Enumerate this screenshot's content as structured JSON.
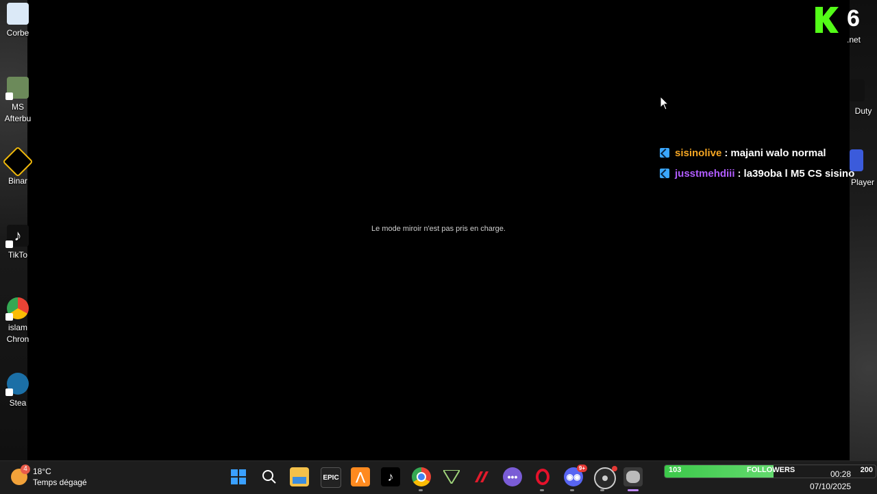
{
  "desktop": {
    "left_icons": [
      {
        "label": "Corbe",
        "icon": "recycle-bin-icon",
        "color": "#5fb3ff"
      },
      {
        "label1": "MS",
        "label2": "Afterbu",
        "icon": "msi-afterburner-icon",
        "color": "#6c8a5a"
      },
      {
        "label": "Binar",
        "icon": "binance-icon",
        "color": "#f0b90b"
      },
      {
        "label": "TikTo",
        "icon": "tiktok-icon",
        "color": "#000000"
      },
      {
        "label1": "islam",
        "label2": "Chron",
        "icon": "chrome-icon",
        "color": "#4285f4"
      },
      {
        "label": "Stea",
        "icon": "steam-icon",
        "color": "#1b2838"
      }
    ],
    "right_icons": [
      {
        "label": ".net",
        "icon": "k6-icon"
      },
      {
        "label": "Duty",
        "icon": "call-of-duty-icon"
      },
      {
        "label": "Player",
        "icon": "player-icon"
      }
    ]
  },
  "logo": {
    "text": "6"
  },
  "mirror_message": "Le mode miroir n'est pas pris en charge.",
  "chat": [
    {
      "user": "sisinolive",
      "user_color": "#f5a623",
      "message": "majani walo normal"
    },
    {
      "user": "jusstmehdiii",
      "user_color": "#b15cff",
      "message": "la39oba l M5 CS sisino"
    }
  ],
  "taskbar": {
    "weather": {
      "temp": "18°C",
      "condition": "Temps dégagé",
      "alert_count": "4"
    },
    "apps": [
      {
        "icon": "windows-start-icon"
      },
      {
        "icon": "search-icon"
      },
      {
        "icon": "file-explorer-icon"
      },
      {
        "icon": "epic-games-icon",
        "label": "EPIC"
      },
      {
        "icon": "fl-studio-icon"
      },
      {
        "icon": "tiktok-icon"
      },
      {
        "icon": "chrome-icon"
      },
      {
        "icon": "vegas-icon"
      },
      {
        "icon": "msi-dragon-icon"
      },
      {
        "icon": "chat-bubble-icon"
      },
      {
        "icon": "opera-icon"
      },
      {
        "icon": "discord-icon",
        "badge": "9+"
      },
      {
        "icon": "obs-icon"
      },
      {
        "icon": "raccoon-app-icon"
      }
    ],
    "followers": {
      "current": "103",
      "label": "FOLLOWERS",
      "goal": "200",
      "progress": 0.515
    },
    "clock": {
      "time": "00:28",
      "date": "07/10/2025"
    }
  }
}
